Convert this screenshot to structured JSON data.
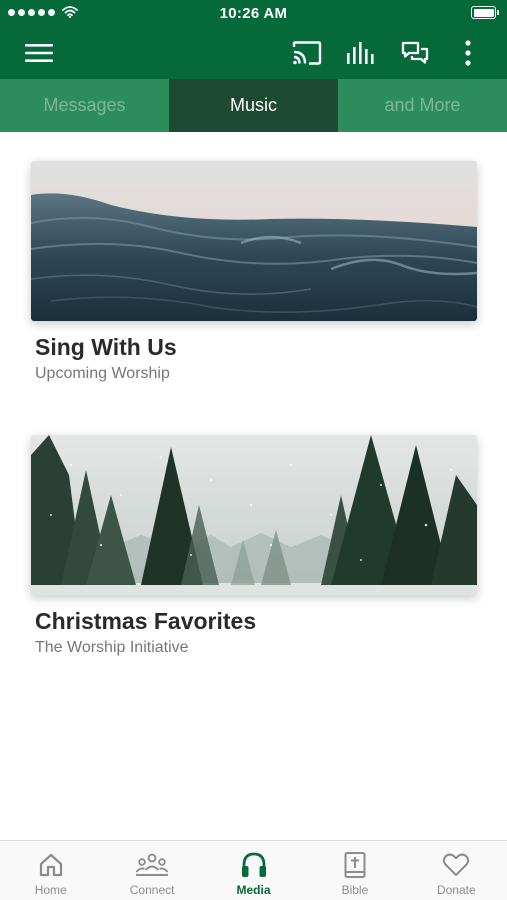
{
  "status_bar": {
    "time": "10:26 AM"
  },
  "tabs": [
    {
      "label": "Messages",
      "active": false
    },
    {
      "label": "Music",
      "active": true
    },
    {
      "label": "and More",
      "active": false
    }
  ],
  "cards": [
    {
      "title": "Sing With Us",
      "subtitle": "Upcoming Worship"
    },
    {
      "title": "Christmas Favorites",
      "subtitle": "The Worship Initiative"
    }
  ],
  "bottom_nav": [
    {
      "label": "Home",
      "icon": "home-icon",
      "active": false
    },
    {
      "label": "Connect",
      "icon": "people-icon",
      "active": false
    },
    {
      "label": "Media",
      "icon": "headphones-icon",
      "active": true
    },
    {
      "label": "Bible",
      "icon": "bible-icon",
      "active": false
    },
    {
      "label": "Donate",
      "icon": "heart-icon",
      "active": false
    }
  ],
  "colors": {
    "brand": "#06693a",
    "tab_bar": "#2d8c5b",
    "tab_active": "#1e4a34",
    "nav_inactive": "#8c8c8c"
  }
}
